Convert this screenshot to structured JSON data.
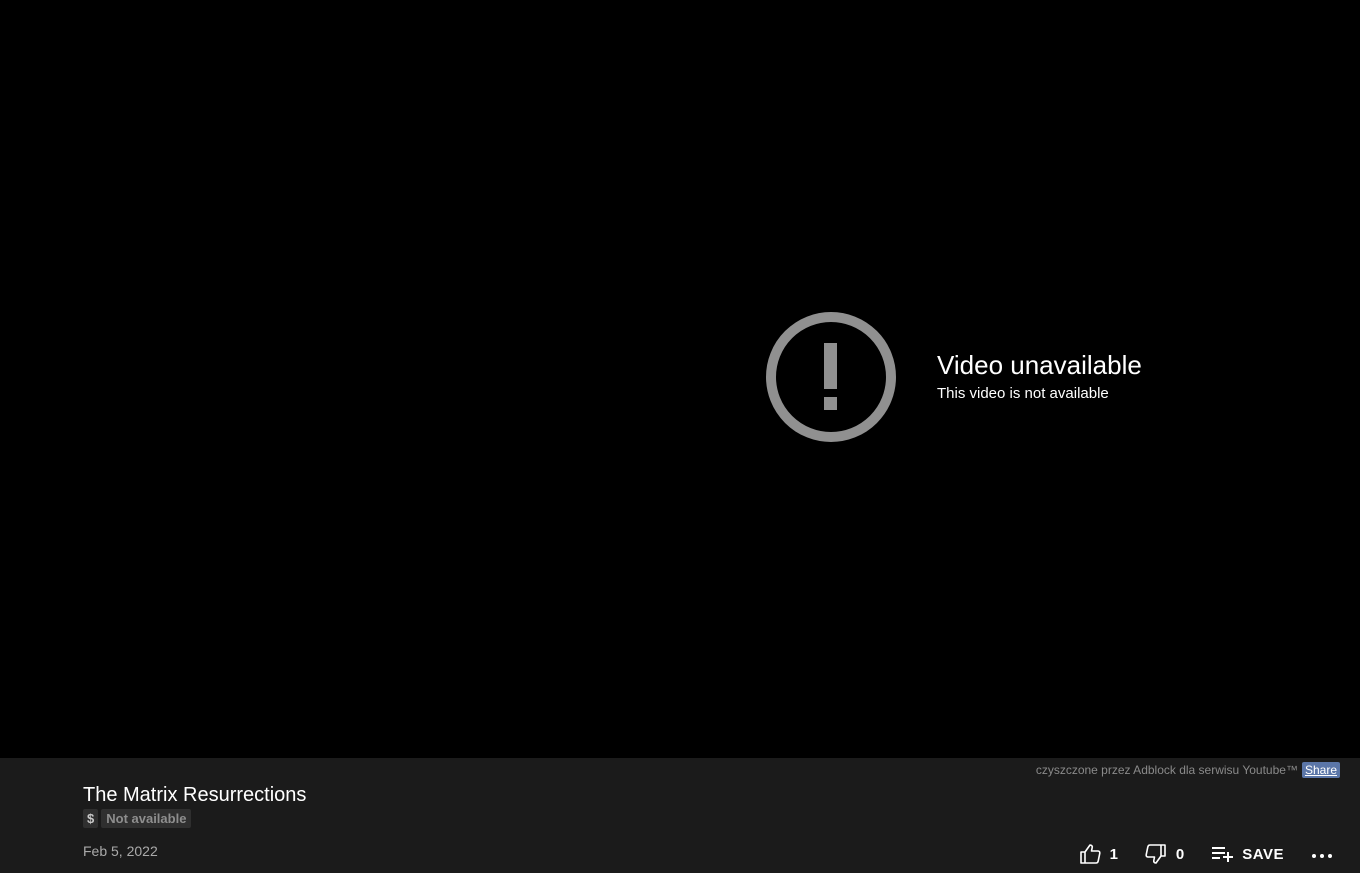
{
  "player": {
    "error_title": "Video unavailable",
    "error_subtitle": "This video is not available",
    "error_icon": "exclamation-circle-icon",
    "icon_color": "#909090"
  },
  "info": {
    "adblock_note": "czyszczone przez Adblock dla serwisu Youtube™",
    "share_label": "Share",
    "title": "The Matrix Resurrections",
    "badges": {
      "price": "$",
      "status": "Not available"
    },
    "date": "Feb 5, 2022"
  },
  "actions": {
    "likes": "1",
    "dislikes": "0",
    "save_label": "SAVE",
    "icons": [
      "thumb-up-icon",
      "thumb-down-icon",
      "playlist-add-icon",
      "more-horizontal-icon"
    ]
  }
}
